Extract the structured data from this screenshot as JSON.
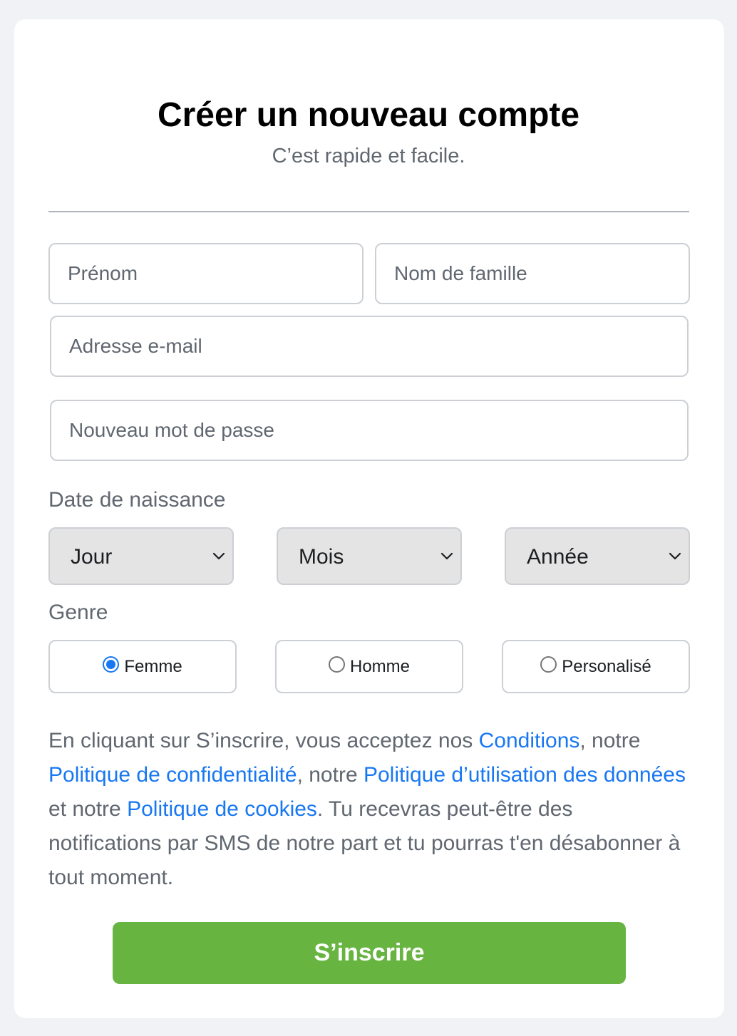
{
  "header": {
    "title": "Créer un nouveau compte",
    "subtitle": "C’est rapide et facile."
  },
  "form": {
    "first_name": {
      "placeholder": "Prénom",
      "value": ""
    },
    "last_name": {
      "placeholder": "Nom de famille",
      "value": ""
    },
    "email": {
      "placeholder": "Adresse e-mail",
      "value": ""
    },
    "password": {
      "placeholder": "Nouveau mot de passe",
      "value": ""
    }
  },
  "birthdate": {
    "label": "Date de naissance",
    "day": "Jour",
    "month": "Mois",
    "year": "Année"
  },
  "gender": {
    "label": "Genre",
    "options": [
      {
        "label": "Femme",
        "selected": true
      },
      {
        "label": "Homme",
        "selected": false
      },
      {
        "label": "Personalisé",
        "selected": false
      }
    ]
  },
  "legal": {
    "t1": "En cliquant sur S’inscrire, vous acceptez nos ",
    "link_terms": "Conditions",
    "t2": ", notre ",
    "link_privacy": "Politique de confidentialité",
    "t3": ", notre ",
    "link_data": "Politique d’utilisation des données",
    "t4": " et notre ",
    "link_cookies": "Politique de cookies",
    "t5": ". Tu recevras peut-être des notifications par SMS de notre part et tu pourras t'en désabonner à tout moment."
  },
  "submit": {
    "label": "S’inscrire"
  },
  "colors": {
    "link": "#1877f2",
    "submit": "#67b441",
    "background": "#f0f2f5",
    "muted_text": "#606770"
  }
}
